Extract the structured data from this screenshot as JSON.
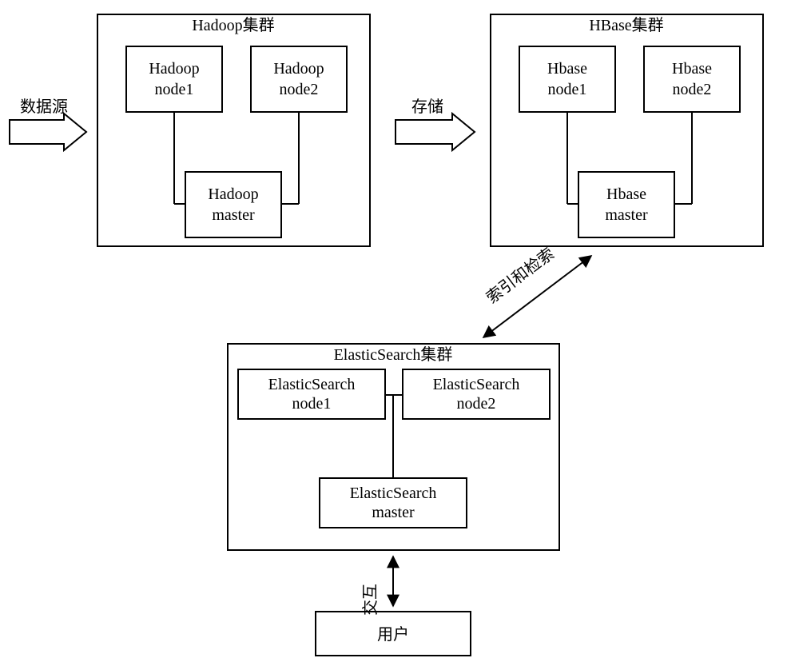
{
  "arrows": {
    "data_source": "数据源",
    "storage": "存储",
    "index_search": "索引和检索",
    "interact": "交互"
  },
  "hadoop": {
    "title": "Hadoop集群",
    "node1_l1": "Hadoop",
    "node1_l2": "node1",
    "node2_l1": "Hadoop",
    "node2_l2": "node2",
    "master_l1": "Hadoop",
    "master_l2": "master"
  },
  "hbase": {
    "title": "HBase集群",
    "node1_l1": "Hbase",
    "node1_l2": "node1",
    "node2_l1": "Hbase",
    "node2_l2": "node2",
    "master_l1": "Hbase",
    "master_l2": "master"
  },
  "es": {
    "title": "ElasticSearch集群",
    "node1_l1": "ElasticSearch",
    "node1_l2": "node1",
    "node2_l1": "ElasticSearch",
    "node2_l2": "node2",
    "master_l1": "ElasticSearch",
    "master_l2": "master"
  },
  "user": "用户"
}
